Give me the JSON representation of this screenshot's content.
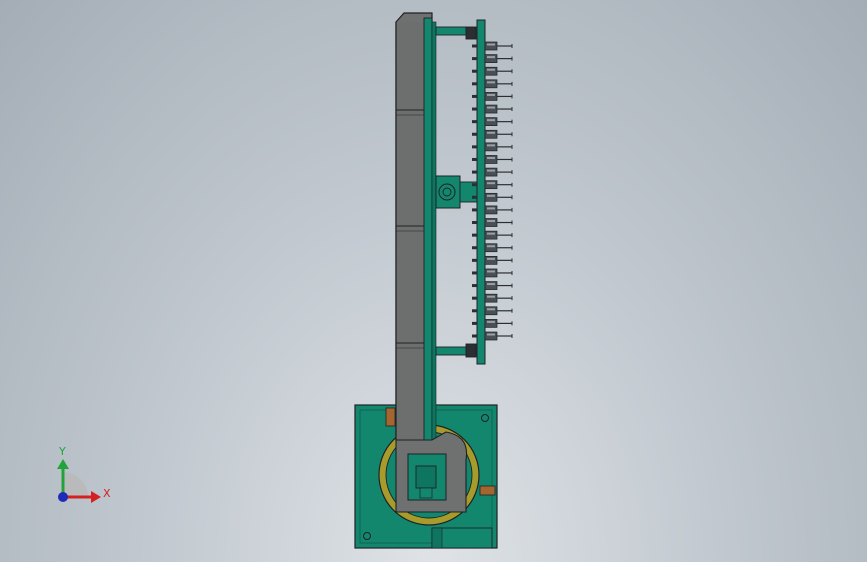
{
  "viewport": {
    "background_top": "#a4adb6",
    "background_bottom": "#dfe3e7"
  },
  "colors": {
    "column_gray": "#6f7070",
    "column_gray_light": "#848585",
    "teal": "#13866e",
    "teal_dark": "#0b5f4e",
    "base_yellow": "#a79c2b",
    "bronze": "#a5652f",
    "outline": "#1e2226"
  },
  "model": {
    "nozzle_count": 24
  },
  "triad": {
    "y_label": "Y",
    "x_label": "X",
    "y_color": "#22a33a",
    "x_color": "#d42020",
    "z_color": "#1d2bb8"
  }
}
